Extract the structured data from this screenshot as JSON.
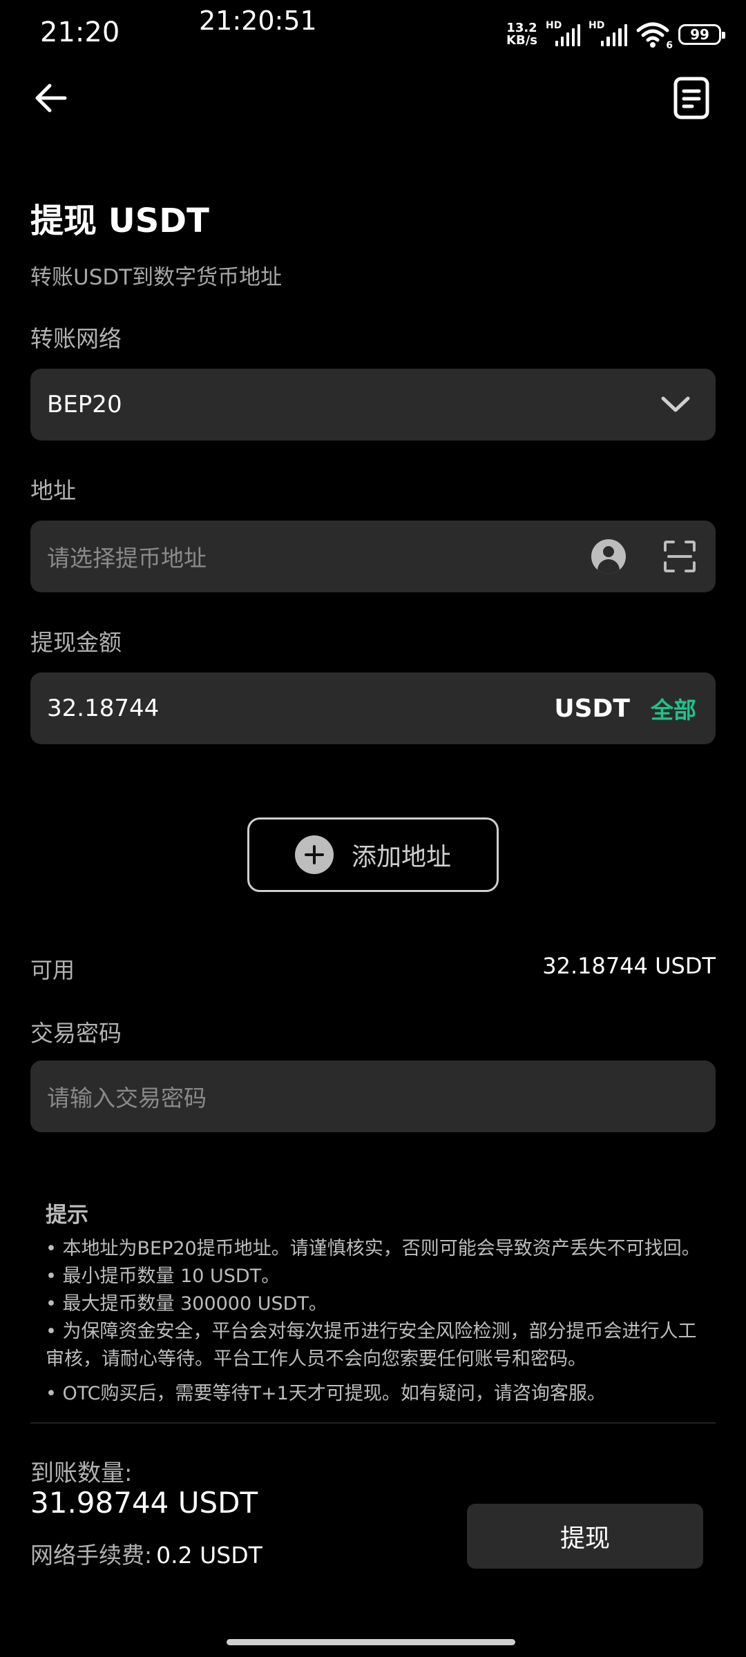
{
  "status_bar": {
    "time": "21:20",
    "clock_overlay": "21:20:51",
    "net_speed_value": "13.2",
    "net_speed_unit": "KB/s",
    "hd1": "HD",
    "hd2": "HD",
    "wifi_badge": "6",
    "battery": "99"
  },
  "header": {
    "back_icon": "arrow-left-icon",
    "record_icon": "document-list-icon"
  },
  "page": {
    "title": "提现 USDT",
    "subtitle": "转账USDT到数字货币地址"
  },
  "network": {
    "label": "转账网络",
    "value": "BEP20",
    "icon": "chevron-down-icon"
  },
  "address": {
    "label": "地址",
    "placeholder": "请选择提币地址",
    "contact_icon": "contact-icon",
    "scan_icon": "scan-icon"
  },
  "amount": {
    "label": "提现金额",
    "value": "32.18744",
    "unit": "USDT",
    "all_label": "全部"
  },
  "add_address": {
    "label": "添加地址",
    "icon": "plus-circle-icon"
  },
  "available": {
    "label": "可用",
    "value": "32.18744 USDT"
  },
  "password": {
    "label": "交易密码",
    "placeholder": "请输入交易密码"
  },
  "tips": {
    "title": "提示",
    "items": [
      "• 本地址为BEP20提币地址。请谨慎核实，否则可能会导致资产丢失不可找回。",
      "• 最小提币数量 10 USDT。",
      "• 最大提币数量 300000 USDT。",
      "• 为保障资金安全，平台会对每次提币进行安全风险检测，部分提币会进行人工审核，请耐心等待。平台工作人员不会向您索要任何账号和密码。",
      "• OTC购买后，需要等待T+1天才可提现。如有疑问，请咨询客服。"
    ]
  },
  "summary": {
    "received_label": "到账数量:",
    "received_amount": "31.98744 USDT",
    "fee_label": "网络手续费:",
    "fee_value": "0.2 USDT",
    "submit_label": "提现"
  },
  "colors": {
    "background": "#000000",
    "field_bg": "#2b2b2b",
    "accent_green": "#1fc38a"
  }
}
